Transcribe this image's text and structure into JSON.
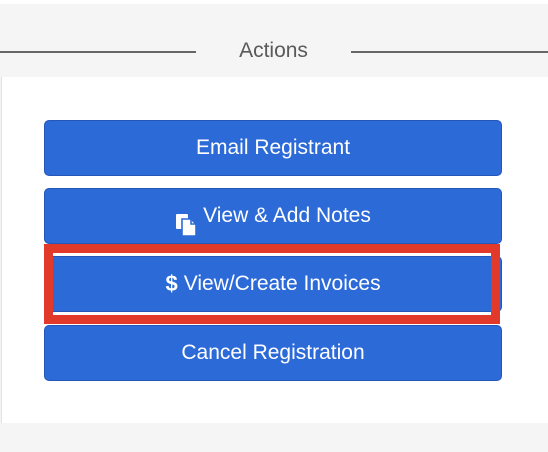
{
  "section": {
    "title": "Actions"
  },
  "buttons": {
    "email": {
      "label": "Email Registrant"
    },
    "notes": {
      "label": "View & Add Notes",
      "icon": "copy-icon"
    },
    "invoices": {
      "label": "View/Create Invoices",
      "icon_text": "$",
      "icon": "dollar-icon"
    },
    "cancel": {
      "label": "Cancel Registration"
    }
  },
  "colors": {
    "button": "#2c6ad8",
    "highlight": "#e23a2a",
    "divider": "#666666"
  }
}
